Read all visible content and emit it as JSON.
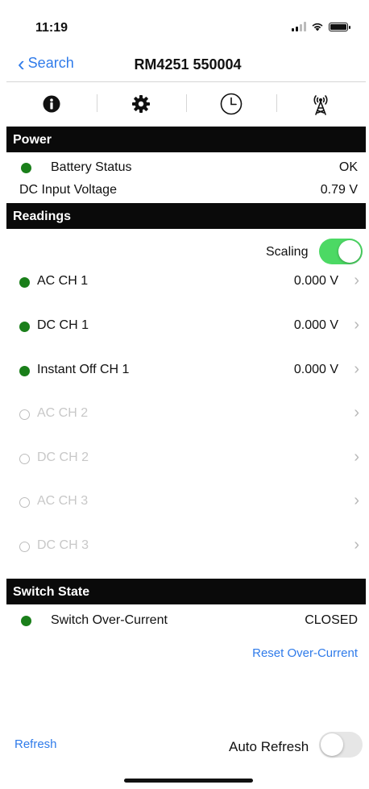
{
  "status_bar": {
    "time": "11:19"
  },
  "nav": {
    "back_label": "Search",
    "title": "RM4251 550004"
  },
  "tabs": [
    {
      "name": "info",
      "icon": "info-icon"
    },
    {
      "name": "settings",
      "icon": "gear-icon"
    },
    {
      "name": "history",
      "icon": "clock-icon"
    },
    {
      "name": "communications",
      "icon": "antenna-tower-icon"
    }
  ],
  "power": {
    "header": "Power",
    "battery_label": "Battery Status",
    "battery_value": "OK",
    "dc_label": "DC Input Voltage",
    "dc_value": "0.79 V"
  },
  "readings": {
    "header": "Readings",
    "scaling_label": "Scaling",
    "scaling_on": true,
    "channels": [
      {
        "label": "AC CH 1",
        "value": "0.000 V",
        "active": true
      },
      {
        "label": "DC CH 1",
        "value": "0.000 V",
        "active": true
      },
      {
        "label": "Instant Off CH 1",
        "value": "0.000 V",
        "active": true
      },
      {
        "label": "AC CH 2",
        "value": "",
        "active": false
      },
      {
        "label": "DC CH 2",
        "value": "",
        "active": false
      },
      {
        "label": "AC CH 3",
        "value": "",
        "active": false
      },
      {
        "label": "DC CH 3",
        "value": "",
        "active": false
      }
    ]
  },
  "switch_state": {
    "header": "Switch State",
    "label": "Switch Over-Current",
    "value": "CLOSED",
    "reset_label": "Reset Over-Current"
  },
  "footer": {
    "refresh_label": "Refresh",
    "auto_refresh_label": "Auto Refresh",
    "auto_refresh_on": false
  },
  "colors": {
    "accent_blue": "#2f7bea",
    "status_green": "#1a7f1a",
    "toggle_green": "#4cd964",
    "header_black": "#0a0a0a"
  }
}
